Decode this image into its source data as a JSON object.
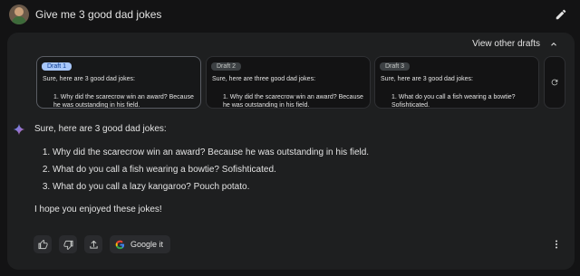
{
  "prompt": {
    "text": "Give me 3 good dad jokes",
    "avatar_icon": "user-avatar",
    "edit_icon": "pencil-icon"
  },
  "drafts_header": {
    "label": "View other drafts",
    "toggle_icon": "chevron-up-icon"
  },
  "drafts": [
    {
      "label": "Draft 1",
      "intro": "Sure, here are 3 good dad jokes:",
      "item": "1. Why did the scarecrow win an award? Because he was outstanding in his field.",
      "active": true
    },
    {
      "label": "Draft 2",
      "intro": "Sure, here are three good dad jokes:",
      "item": "1. Why did the scarecrow win an award? Because he was outstanding in his field.",
      "active": false
    },
    {
      "label": "Draft 3",
      "intro": "Sure, here are 3 good dad jokes:",
      "item": "1. What do you call a fish wearing a bowtie? Sofishticated.",
      "active": false
    }
  ],
  "regenerate_icon": "refresh-icon",
  "response": {
    "intro": "Sure, here are 3 good dad jokes:",
    "jokes": [
      "Why did the scarecrow win an award? Because he was outstanding in his field.",
      "What do you call a fish wearing a bowtie? Sofishticated.",
      "What do you call a lazy kangaroo? Pouch potato."
    ],
    "closing": "I hope you enjoyed these jokes!"
  },
  "actions": {
    "google_label": "Google it",
    "icons": [
      "thumbs-up-icon",
      "thumbs-down-icon",
      "share-icon",
      "google-icon",
      "more-vert-icon"
    ]
  },
  "colors": {
    "background": "#131314",
    "card": "#1e1f20",
    "active_draft_pill": "#a8c7fa",
    "text": "#e3e3e3"
  }
}
